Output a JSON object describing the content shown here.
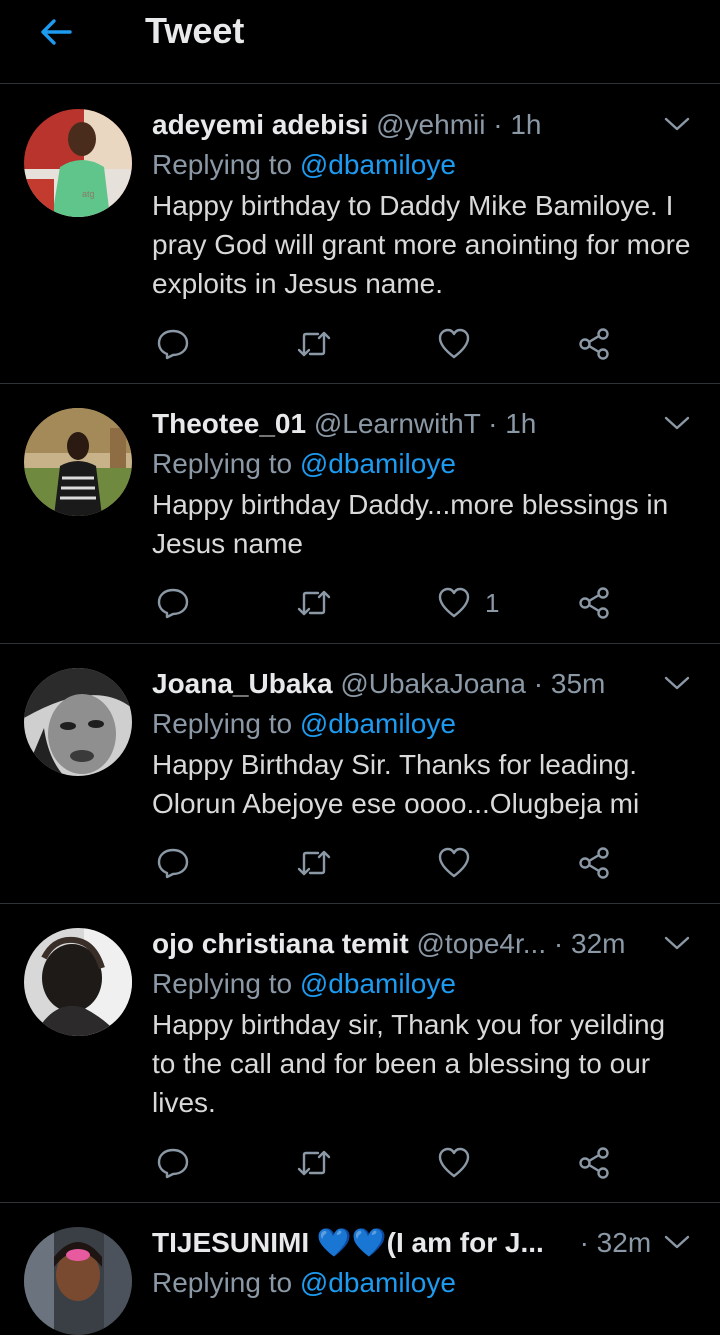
{
  "header": {
    "title": "Tweet"
  },
  "tweets": [
    {
      "name": "adeyemi adebisi",
      "handle": "@yehmii",
      "separator": "·",
      "time": "1h",
      "reply_prefix": "Replying to ",
      "reply_to": "@dbamiloye",
      "text": "Happy birthday to Daddy Mike Bamiloye. I pray God will grant more anointing for more exploits in Jesus name.",
      "like_count": ""
    },
    {
      "name": "Theotee_01",
      "handle": "@LearnwithT",
      "separator": "·",
      "time": "1h",
      "reply_prefix": "Replying to ",
      "reply_to": "@dbamiloye",
      "text": "Happy birthday Daddy...more blessings in Jesus name",
      "like_count": "1"
    },
    {
      "name": "Joana_Ubaka",
      "handle": "@UbakaJoana",
      "separator": "·",
      "time": "35m",
      "reply_prefix": "Replying to ",
      "reply_to": "@dbamiloye",
      "text": "Happy Birthday Sir. Thanks for leading. Olorun Abejoye ese oooo...Olugbeja mi",
      "like_count": ""
    },
    {
      "name": "ojo christiana temit",
      "handle": "@tope4r...",
      "separator": "·",
      "time": "32m",
      "reply_prefix": "Replying to ",
      "reply_to": "@dbamiloye",
      "text": "Happy birthday sir, Thank you for yeilding to the call and for been a blessing to our lives.",
      "like_count": ""
    },
    {
      "name": "TIJESUNIMI 💙💙(I am for J...",
      "handle": "",
      "separator": "·",
      "time": "32m",
      "reply_prefix": "Replying to ",
      "reply_to": "@dbamiloye",
      "text": "",
      "like_count": ""
    }
  ],
  "colors": {
    "background": "#000000",
    "accent": "#1d9bf0",
    "muted": "#8b98a5",
    "divider": "#2f3336"
  },
  "icons": [
    "back-arrow-icon",
    "chevron-down-icon",
    "reply-icon",
    "retweet-icon",
    "heart-icon",
    "share-icon"
  ]
}
